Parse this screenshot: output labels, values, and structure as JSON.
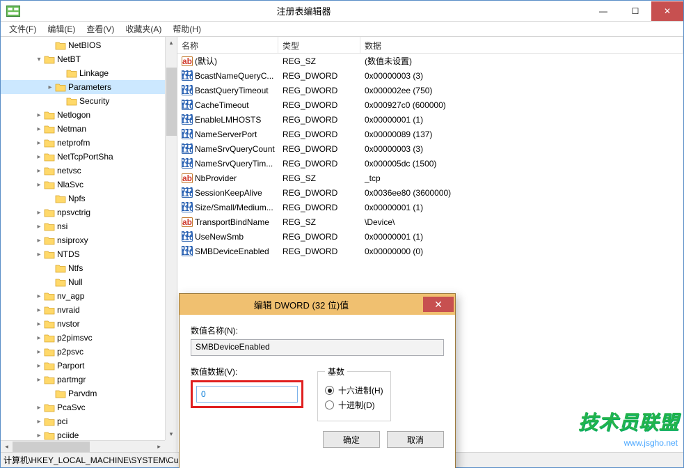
{
  "window": {
    "title": "注册表编辑器"
  },
  "menubar": {
    "file": "文件(F)",
    "edit": "编辑(E)",
    "view": "查看(V)",
    "favorites": "收藏夹(A)",
    "help": "帮助(H)"
  },
  "tree": [
    {
      "indent": 4,
      "expander": "",
      "label": "NetBIOS"
    },
    {
      "indent": 3,
      "expander": "▾",
      "label": "NetBT"
    },
    {
      "indent": 5,
      "expander": "",
      "label": "Linkage"
    },
    {
      "indent": 4,
      "expander": "▸",
      "label": "Parameters",
      "selected": true
    },
    {
      "indent": 5,
      "expander": "",
      "label": "Security"
    },
    {
      "indent": 3,
      "expander": "▸",
      "label": "Netlogon"
    },
    {
      "indent": 3,
      "expander": "▸",
      "label": "Netman"
    },
    {
      "indent": 3,
      "expander": "▸",
      "label": "netprofm"
    },
    {
      "indent": 3,
      "expander": "▸",
      "label": "NetTcpPortSha"
    },
    {
      "indent": 3,
      "expander": "▸",
      "label": "netvsc"
    },
    {
      "indent": 3,
      "expander": "▸",
      "label": "NlaSvc"
    },
    {
      "indent": 4,
      "expander": "",
      "label": "Npfs"
    },
    {
      "indent": 3,
      "expander": "▸",
      "label": "npsvctrig"
    },
    {
      "indent": 3,
      "expander": "▸",
      "label": "nsi"
    },
    {
      "indent": 3,
      "expander": "▸",
      "label": "nsiproxy"
    },
    {
      "indent": 3,
      "expander": "▸",
      "label": "NTDS"
    },
    {
      "indent": 4,
      "expander": "",
      "label": "Ntfs"
    },
    {
      "indent": 4,
      "expander": "",
      "label": "Null"
    },
    {
      "indent": 3,
      "expander": "▸",
      "label": "nv_agp"
    },
    {
      "indent": 3,
      "expander": "▸",
      "label": "nvraid"
    },
    {
      "indent": 3,
      "expander": "▸",
      "label": "nvstor"
    },
    {
      "indent": 3,
      "expander": "▸",
      "label": "p2pimsvc"
    },
    {
      "indent": 3,
      "expander": "▸",
      "label": "p2psvc"
    },
    {
      "indent": 3,
      "expander": "▸",
      "label": "Parport"
    },
    {
      "indent": 3,
      "expander": "▸",
      "label": "partmgr"
    },
    {
      "indent": 4,
      "expander": "",
      "label": "Parvdm"
    },
    {
      "indent": 3,
      "expander": "▸",
      "label": "PcaSvc"
    },
    {
      "indent": 3,
      "expander": "▸",
      "label": "pci"
    },
    {
      "indent": 3,
      "expander": "▸",
      "label": "pciide"
    }
  ],
  "columns": {
    "name": "名称",
    "type": "类型",
    "data": "数据"
  },
  "values": [
    {
      "icon": "sz",
      "name": "(默认)",
      "type": "REG_SZ",
      "data": "(数值未设置)"
    },
    {
      "icon": "dw",
      "name": "BcastNameQueryC...",
      "type": "REG_DWORD",
      "data": "0x00000003 (3)"
    },
    {
      "icon": "dw",
      "name": "BcastQueryTimeout",
      "type": "REG_DWORD",
      "data": "0x000002ee (750)"
    },
    {
      "icon": "dw",
      "name": "CacheTimeout",
      "type": "REG_DWORD",
      "data": "0x000927c0 (600000)"
    },
    {
      "icon": "dw",
      "name": "EnableLMHOSTS",
      "type": "REG_DWORD",
      "data": "0x00000001 (1)"
    },
    {
      "icon": "dw",
      "name": "NameServerPort",
      "type": "REG_DWORD",
      "data": "0x00000089 (137)"
    },
    {
      "icon": "dw",
      "name": "NameSrvQueryCount",
      "type": "REG_DWORD",
      "data": "0x00000003 (3)"
    },
    {
      "icon": "dw",
      "name": "NameSrvQueryTim...",
      "type": "REG_DWORD",
      "data": "0x000005dc (1500)"
    },
    {
      "icon": "sz",
      "name": "NbProvider",
      "type": "REG_SZ",
      "data": "_tcp"
    },
    {
      "icon": "dw",
      "name": "SessionKeepAlive",
      "type": "REG_DWORD",
      "data": "0x0036ee80 (3600000)"
    },
    {
      "icon": "dw",
      "name": "Size/Small/Medium...",
      "type": "REG_DWORD",
      "data": "0x00000001 (1)"
    },
    {
      "icon": "sz",
      "name": "TransportBindName",
      "type": "REG_SZ",
      "data": "\\Device\\"
    },
    {
      "icon": "dw",
      "name": "UseNewSmb",
      "type": "REG_DWORD",
      "data": "0x00000001 (1)"
    },
    {
      "icon": "dw",
      "name": "SMBDeviceEnabled",
      "type": "REG_DWORD",
      "data": "0x00000000 (0)"
    }
  ],
  "dialog": {
    "title": "编辑 DWORD (32 位)值",
    "name_label": "数值名称(N):",
    "name_value": "SMBDeviceEnabled",
    "data_label": "数值数据(V):",
    "data_value": "0",
    "base_label": "基数",
    "hex_label": "十六进制(H)",
    "dec_label": "十进制(D)",
    "ok": "确定",
    "cancel": "取消"
  },
  "statusbar": {
    "path": "计算机\\HKEY_LOCAL_MACHINE\\SYSTEM\\CurrentControlSet\\Services\\NetBT\\Parameters"
  },
  "watermark": {
    "main": "技术员联盟",
    "sub": "www.jsgho.net"
  }
}
